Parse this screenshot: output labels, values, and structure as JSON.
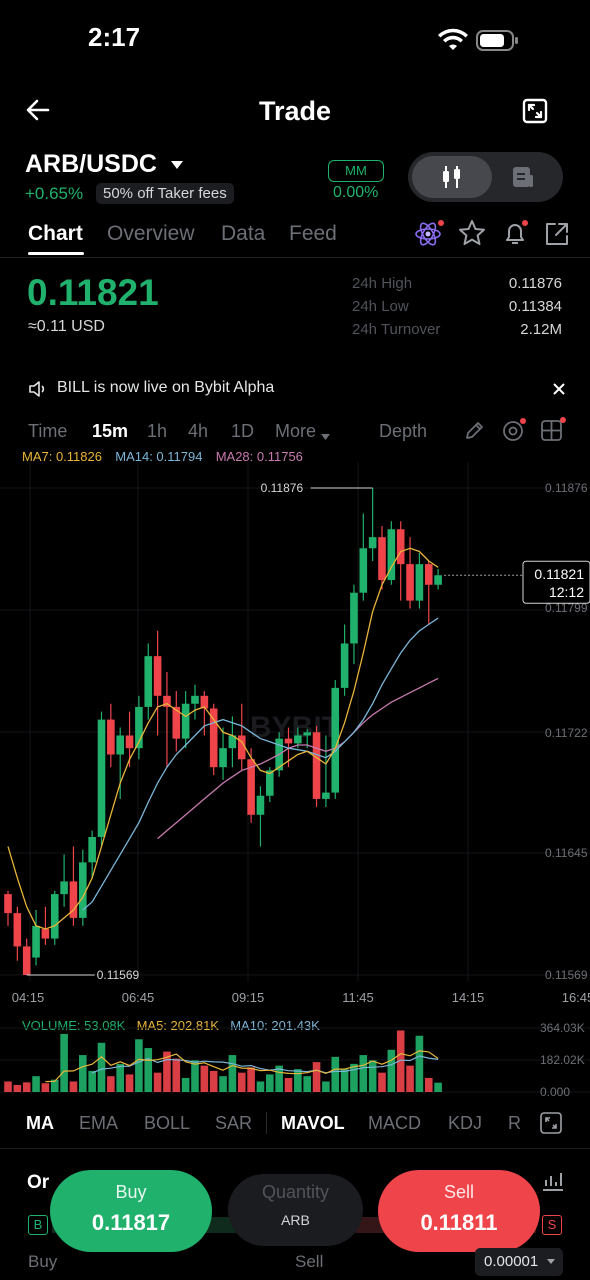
{
  "status": {
    "time": "2:17"
  },
  "header": {
    "title": "Trade"
  },
  "pair": {
    "symbol": "ARB/USDC",
    "change": "+0.65%",
    "fee_badge": "50% off Taker fees",
    "mm_label": "MM",
    "mm_value": "0.00%"
  },
  "tabs": [
    "Chart",
    "Overview",
    "Data",
    "Feed"
  ],
  "price": {
    "last": "0.11821",
    "usd": "≈0.11 USD",
    "stats": [
      {
        "label": "24h High",
        "value": "0.11876"
      },
      {
        "label": "24h Low",
        "value": "0.11384"
      },
      {
        "label": "24h Turnover",
        "value": "2.12M"
      }
    ]
  },
  "announcement": {
    "text": "BILL is now live on Bybit Alpha"
  },
  "timeframes": {
    "items": [
      "Time",
      "15m",
      "1h",
      "4h",
      "1D"
    ],
    "more": "More",
    "depth": "Depth",
    "selected": "15m"
  },
  "ma_legend": {
    "ma7": "MA7: 0.11826",
    "ma14": "MA14: 0.11794",
    "ma28": "MA28: 0.11756"
  },
  "chart_data": [
    {
      "type": "candlestick",
      "x_labels": [
        "04:15",
        "06:45",
        "09:15",
        "11:45",
        "14:15",
        "16:45"
      ],
      "y_labels": [
        "0.11876",
        "0.11799",
        "0.11722",
        "0.11645",
        "0.11569"
      ],
      "ylim": [
        0.11569,
        0.11876
      ],
      "high_marker": "0.11876",
      "low_marker": "0.11569",
      "current_price": "0.11821",
      "countdown": "12:12",
      "watermark": "BYBIT",
      "candles": [
        {
          "o": 0.1162,
          "h": 0.11622,
          "c": 0.11608,
          "l": 0.116
        },
        {
          "o": 0.11608,
          "h": 0.11612,
          "c": 0.11587,
          "l": 0.11578
        },
        {
          "o": 0.11587,
          "h": 0.11592,
          "c": 0.11569,
          "l": 0.11569
        },
        {
          "o": 0.1158,
          "h": 0.1161,
          "c": 0.116,
          "l": 0.11575
        },
        {
          "o": 0.11598,
          "h": 0.11612,
          "c": 0.11592,
          "l": 0.11588
        },
        {
          "o": 0.11592,
          "h": 0.11622,
          "c": 0.1162,
          "l": 0.11588
        },
        {
          "o": 0.1162,
          "h": 0.11645,
          "c": 0.11628,
          "l": 0.11612
        },
        {
          "o": 0.11628,
          "h": 0.1165,
          "c": 0.11605,
          "l": 0.116
        },
        {
          "o": 0.11605,
          "h": 0.11648,
          "c": 0.1164,
          "l": 0.116
        },
        {
          "o": 0.1164,
          "h": 0.1166,
          "c": 0.11656,
          "l": 0.1163
        },
        {
          "o": 0.11656,
          "h": 0.11735,
          "c": 0.1173,
          "l": 0.1165
        },
        {
          "o": 0.1173,
          "h": 0.1174,
          "c": 0.11708,
          "l": 0.117
        },
        {
          "o": 0.11708,
          "h": 0.11725,
          "c": 0.1172,
          "l": 0.1168
        },
        {
          "o": 0.1172,
          "h": 0.11735,
          "c": 0.11712,
          "l": 0.117
        },
        {
          "o": 0.11712,
          "h": 0.11745,
          "c": 0.11738,
          "l": 0.11705
        },
        {
          "o": 0.11738,
          "h": 0.11778,
          "c": 0.1177,
          "l": 0.1173
        },
        {
          "o": 0.1177,
          "h": 0.11786,
          "c": 0.11745,
          "l": 0.1172
        },
        {
          "o": 0.11745,
          "h": 0.1176,
          "c": 0.11738,
          "l": 0.117
        },
        {
          "o": 0.11738,
          "h": 0.11748,
          "c": 0.11718,
          "l": 0.1171
        },
        {
          "o": 0.11718,
          "h": 0.11748,
          "c": 0.1174,
          "l": 0.11712
        },
        {
          "o": 0.1174,
          "h": 0.11752,
          "c": 0.11745,
          "l": 0.1173
        },
        {
          "o": 0.11745,
          "h": 0.11748,
          "c": 0.11737,
          "l": 0.1172
        },
        {
          "o": 0.11737,
          "h": 0.1174,
          "c": 0.117,
          "l": 0.11695
        },
        {
          "o": 0.117,
          "h": 0.11725,
          "c": 0.11712,
          "l": 0.11692
        },
        {
          "o": 0.11712,
          "h": 0.11732,
          "c": 0.1172,
          "l": 0.117
        },
        {
          "o": 0.1172,
          "h": 0.1174,
          "c": 0.11705,
          "l": 0.11698
        },
        {
          "o": 0.11705,
          "h": 0.11712,
          "c": 0.1167,
          "l": 0.11665
        },
        {
          "o": 0.1167,
          "h": 0.11688,
          "c": 0.11682,
          "l": 0.1165
        },
        {
          "o": 0.11682,
          "h": 0.117,
          "c": 0.11698,
          "l": 0.11678
        },
        {
          "o": 0.11698,
          "h": 0.11722,
          "c": 0.11718,
          "l": 0.11694
        },
        {
          "o": 0.11718,
          "h": 0.11725,
          "c": 0.11715,
          "l": 0.117
        },
        {
          "o": 0.11715,
          "h": 0.11725,
          "c": 0.1172,
          "l": 0.11712
        },
        {
          "o": 0.1172,
          "h": 0.11724,
          "c": 0.11722,
          "l": 0.11712
        },
        {
          "o": 0.11722,
          "h": 0.11726,
          "c": 0.1168,
          "l": 0.11675
        },
        {
          "o": 0.1168,
          "h": 0.1172,
          "c": 0.11684,
          "l": 0.11675
        },
        {
          "o": 0.11684,
          "h": 0.11755,
          "c": 0.1175,
          "l": 0.1168
        },
        {
          "o": 0.1175,
          "h": 0.1179,
          "c": 0.11778,
          "l": 0.11745
        },
        {
          "o": 0.11778,
          "h": 0.11815,
          "c": 0.1181,
          "l": 0.11765
        },
        {
          "o": 0.1181,
          "h": 0.1186,
          "c": 0.11838,
          "l": 0.11805
        },
        {
          "o": 0.11838,
          "h": 0.11876,
          "c": 0.11845,
          "l": 0.1183
        },
        {
          "o": 0.11845,
          "h": 0.11852,
          "c": 0.11818,
          "l": 0.11812
        },
        {
          "o": 0.11818,
          "h": 0.11855,
          "c": 0.1185,
          "l": 0.11815
        },
        {
          "o": 0.1185,
          "h": 0.11855,
          "c": 0.11828,
          "l": 0.11805
        },
        {
          "o": 0.11828,
          "h": 0.11845,
          "c": 0.11805,
          "l": 0.118
        },
        {
          "o": 0.11805,
          "h": 0.11835,
          "c": 0.11828,
          "l": 0.118
        },
        {
          "o": 0.11828,
          "h": 0.1183,
          "c": 0.11815,
          "l": 0.1179
        },
        {
          "o": 0.11815,
          "h": 0.11825,
          "c": 0.11821,
          "l": 0.11812
        }
      ],
      "ma7": [
        0.1165,
        0.1163,
        0.11612,
        0.116,
        0.11598,
        0.116,
        0.11605,
        0.1161,
        0.11618,
        0.1163,
        0.1165,
        0.1167,
        0.1169,
        0.11705,
        0.11716,
        0.11728,
        0.11738,
        0.1174,
        0.11736,
        0.11732,
        0.11736,
        0.11738,
        0.1173,
        0.11722,
        0.1172,
        0.11716,
        0.11706,
        0.11698,
        0.11696,
        0.117,
        0.11704,
        0.11708,
        0.1171,
        0.11706,
        0.11702,
        0.11712,
        0.11728,
        0.11748,
        0.11772,
        0.11798,
        0.11815,
        0.11826,
        0.11836,
        0.11838,
        0.11836,
        0.1183,
        0.11826
      ],
      "ma14": [
        null,
        null,
        null,
        null,
        null,
        null,
        null,
        null,
        0.1161,
        0.11615,
        0.11625,
        0.11635,
        0.11645,
        0.11655,
        0.11665,
        0.11678,
        0.1169,
        0.117,
        0.11708,
        0.11714,
        0.1172,
        0.11726,
        0.11728,
        0.1173,
        0.11728,
        0.11726,
        0.11722,
        0.11718,
        0.11716,
        0.11714,
        0.11712,
        0.11711,
        0.1171,
        0.11708,
        0.11706,
        0.1171,
        0.11716,
        0.11722,
        0.1173,
        0.1174,
        0.11752,
        0.11762,
        0.11772,
        0.1178,
        0.11786,
        0.1179,
        0.11794
      ],
      "ma28": [
        null,
        null,
        null,
        null,
        null,
        null,
        null,
        null,
        null,
        null,
        null,
        null,
        null,
        null,
        null,
        null,
        0.11655,
        0.1166,
        0.11665,
        0.1167,
        0.11675,
        0.1168,
        0.11685,
        0.1169,
        0.11694,
        0.11698,
        0.117,
        0.11702,
        0.11705,
        0.11708,
        0.11712,
        0.11714,
        0.11714,
        0.11712,
        0.1171,
        0.11712,
        0.11716,
        0.11722,
        0.11728,
        0.11733,
        0.11737,
        0.11741,
        0.11744,
        0.11747,
        0.1175,
        0.11753,
        0.11756
      ]
    },
    {
      "type": "bar",
      "volume_legend": {
        "volume": "VOLUME: 53.08K",
        "ma5": "MA5: 202.81K",
        "ma10": "MA10: 201.43K"
      },
      "y_labels": [
        "364.03K",
        "182.02K",
        "0.000"
      ],
      "ylim": [
        0,
        364030
      ],
      "values": [
        60000,
        40000,
        55000,
        90000,
        50000,
        70000,
        330000,
        60000,
        210000,
        120000,
        280000,
        90000,
        160000,
        100000,
        300000,
        250000,
        110000,
        230000,
        190000,
        80000,
        180000,
        150000,
        120000,
        90000,
        210000,
        110000,
        140000,
        60000,
        100000,
        150000,
        80000,
        130000,
        90000,
        170000,
        60000,
        200000,
        130000,
        160000,
        210000,
        180000,
        110000,
        240000,
        350000,
        150000,
        320000,
        80000,
        53080
      ]
    }
  ],
  "indicators": {
    "main": [
      "MA",
      "EMA",
      "BOLL",
      "SAR"
    ],
    "sub": [
      "MAVOL",
      "MACD",
      "KDJ",
      "R"
    ]
  },
  "trade": {
    "buy_label": "Buy",
    "buy_price": "0.11817",
    "quantity_label": "Quantity",
    "quantity_unit": "ARB",
    "sell_label": "Sell",
    "sell_price": "0.11811",
    "orderbook_title": "Or",
    "orderbook_buy": "Buy",
    "orderbook_sell": "Sell",
    "tick_size": "0.00001"
  },
  "colors": {
    "up": "#20b26c",
    "down": "#ef454a",
    "ma7": "#e8b53a",
    "ma14": "#7ab6d8",
    "ma28": "#c77bb0"
  }
}
